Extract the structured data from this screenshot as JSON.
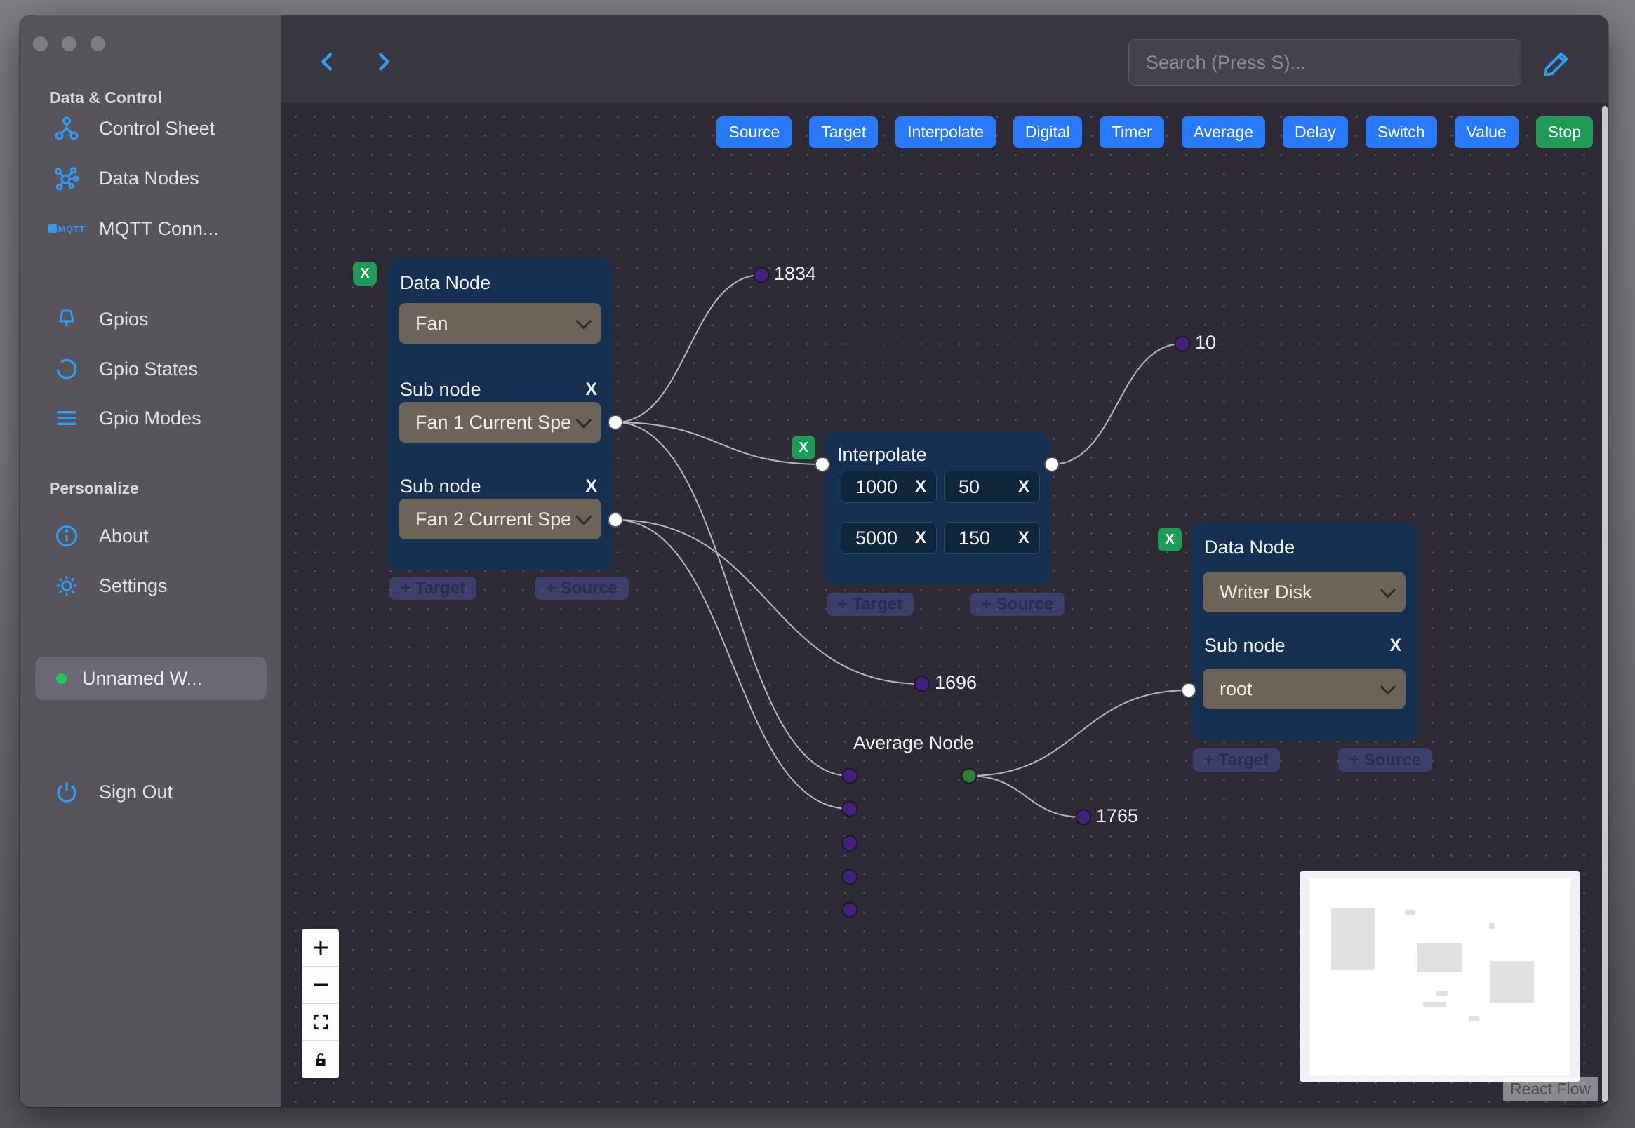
{
  "colors": {
    "accent_blue": "#2e9ef7",
    "button_blue": "#2979fb",
    "button_green": "#1d9b57",
    "node_bg": "#153050",
    "select_bg": "#6c6359",
    "edge_gray": "#b8b6bc",
    "handle_purple": "#45217b",
    "handle_green": "#2e7d33",
    "status_green": "#22c55e",
    "sidebar_bg": "#57545c",
    "canvas_bg": "#2e2b37"
  },
  "sidebar": {
    "section_data_control": "Data & Control",
    "items": [
      {
        "label": "Control Sheet",
        "icon": "control-sheet-icon"
      },
      {
        "label": "Data Nodes",
        "icon": "data-nodes-icon"
      },
      {
        "label": "MQTT Conn...",
        "icon": "mqtt-icon"
      },
      {
        "label": "Gpios",
        "icon": "gpio-pin-icon"
      },
      {
        "label": "Gpio States",
        "icon": "gpio-states-icon"
      },
      {
        "label": "Gpio Modes",
        "icon": "gpio-modes-icon"
      }
    ],
    "section_personalize": "Personalize",
    "personalize_items": [
      {
        "label": "About",
        "icon": "info-icon"
      },
      {
        "label": "Settings",
        "icon": "gear-icon"
      }
    ],
    "workspace": {
      "label": "Unnamed W...",
      "status": "online"
    },
    "signout_label": "Sign Out"
  },
  "topbar": {
    "search_placeholder": "Search (Press S)...",
    "back_icon": "chevron-left-icon",
    "forward_icon": "chevron-right-icon",
    "edit_icon": "pencil-icon"
  },
  "palette": {
    "buttons": [
      "Source",
      "Target",
      "Interpolate",
      "Digital",
      "Timer",
      "Average",
      "Delay",
      "Switch",
      "Value"
    ],
    "stop_button": "Stop"
  },
  "nodes": {
    "fan": {
      "title": "Data Node",
      "type_value": "Fan",
      "sub1_label": "Sub node",
      "sub1_remove": "X",
      "sub1_value": "Fan 1 Current Spe",
      "sub2_label": "Sub node",
      "sub2_remove": "X",
      "sub2_value": "Fan 2 Current Spe",
      "delete_label": "X",
      "target_pill": "+ Target",
      "source_pill": "+ Source"
    },
    "interpolate": {
      "title": "Interpolate",
      "inputs": [
        {
          "value": "1000",
          "remove": "X"
        },
        {
          "value": "50",
          "remove": "X"
        },
        {
          "value": "5000",
          "remove": "X"
        },
        {
          "value": "150",
          "remove": "X"
        }
      ],
      "delete_label": "X",
      "target_pill": "+ Target",
      "source_pill": "+ Source"
    },
    "writer": {
      "title": "Data Node",
      "type_value": "Writer Disk",
      "sub_label": "Sub node",
      "sub_remove": "X",
      "sub_value": "root",
      "delete_label": "X",
      "target_pill": "+ Target",
      "source_pill": "+ Source"
    },
    "average": {
      "label": "Average Node"
    }
  },
  "edge_labels": {
    "v1834": "1834",
    "v10": "10",
    "v1696": "1696",
    "v1765": "1765"
  },
  "controls": {
    "zoom_in": "plus-icon",
    "zoom_out": "minus-icon",
    "fit_view": "fit-view-icon",
    "lock": "lock-icon"
  },
  "minimap": {
    "attribution": "React Flow"
  }
}
